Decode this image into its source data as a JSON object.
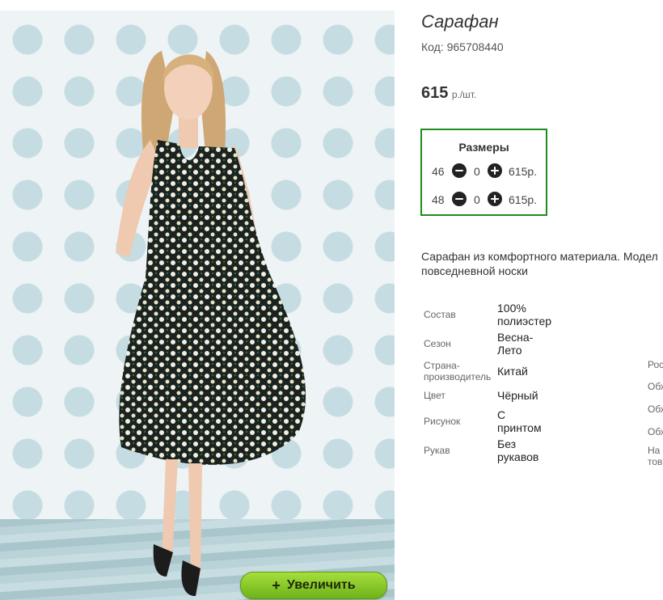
{
  "product": {
    "title": "Сарафан",
    "code": "Код: 965708440",
    "price": "615",
    "price_unit": "р./шт."
  },
  "photo": {
    "zoom_button": {
      "icon": "plus-icon",
      "label": "Увеличить"
    }
  },
  "sizes": {
    "title": "Размеры",
    "rows": [
      {
        "size": "46",
        "qty": "0",
        "price": "615р."
      },
      {
        "size": "48",
        "qty": "0",
        "price": "615р."
      }
    ]
  },
  "description": {
    "line1": "Сарафан из комфортного материала. Модел",
    "line2": "повседневной носки"
  },
  "specs": [
    {
      "label": "Состав",
      "value_lines": [
        "100%",
        "полиэстер"
      ]
    },
    {
      "label": "Сезон",
      "value_lines": [
        "Весна-",
        "Лето"
      ]
    },
    {
      "label_lines": [
        "Страна-",
        "производитель"
      ],
      "value_lines": [
        "Китай"
      ]
    },
    {
      "label": "Цвет",
      "value_lines": [
        "Чёрный"
      ]
    },
    {
      "label": "Рисунок",
      "value_lines": [
        "С",
        "принтом"
      ]
    },
    {
      "label": "Рукав",
      "value_lines": [
        "Без",
        "рукавов"
      ]
    }
  ],
  "specs_cut": [
    "Рос",
    "Обх",
    "Обх",
    "Обх",
    "На",
    "тов"
  ],
  "colors": {
    "sizes_border": "#1e8c1e",
    "zoom_button": "#8bc92a"
  }
}
